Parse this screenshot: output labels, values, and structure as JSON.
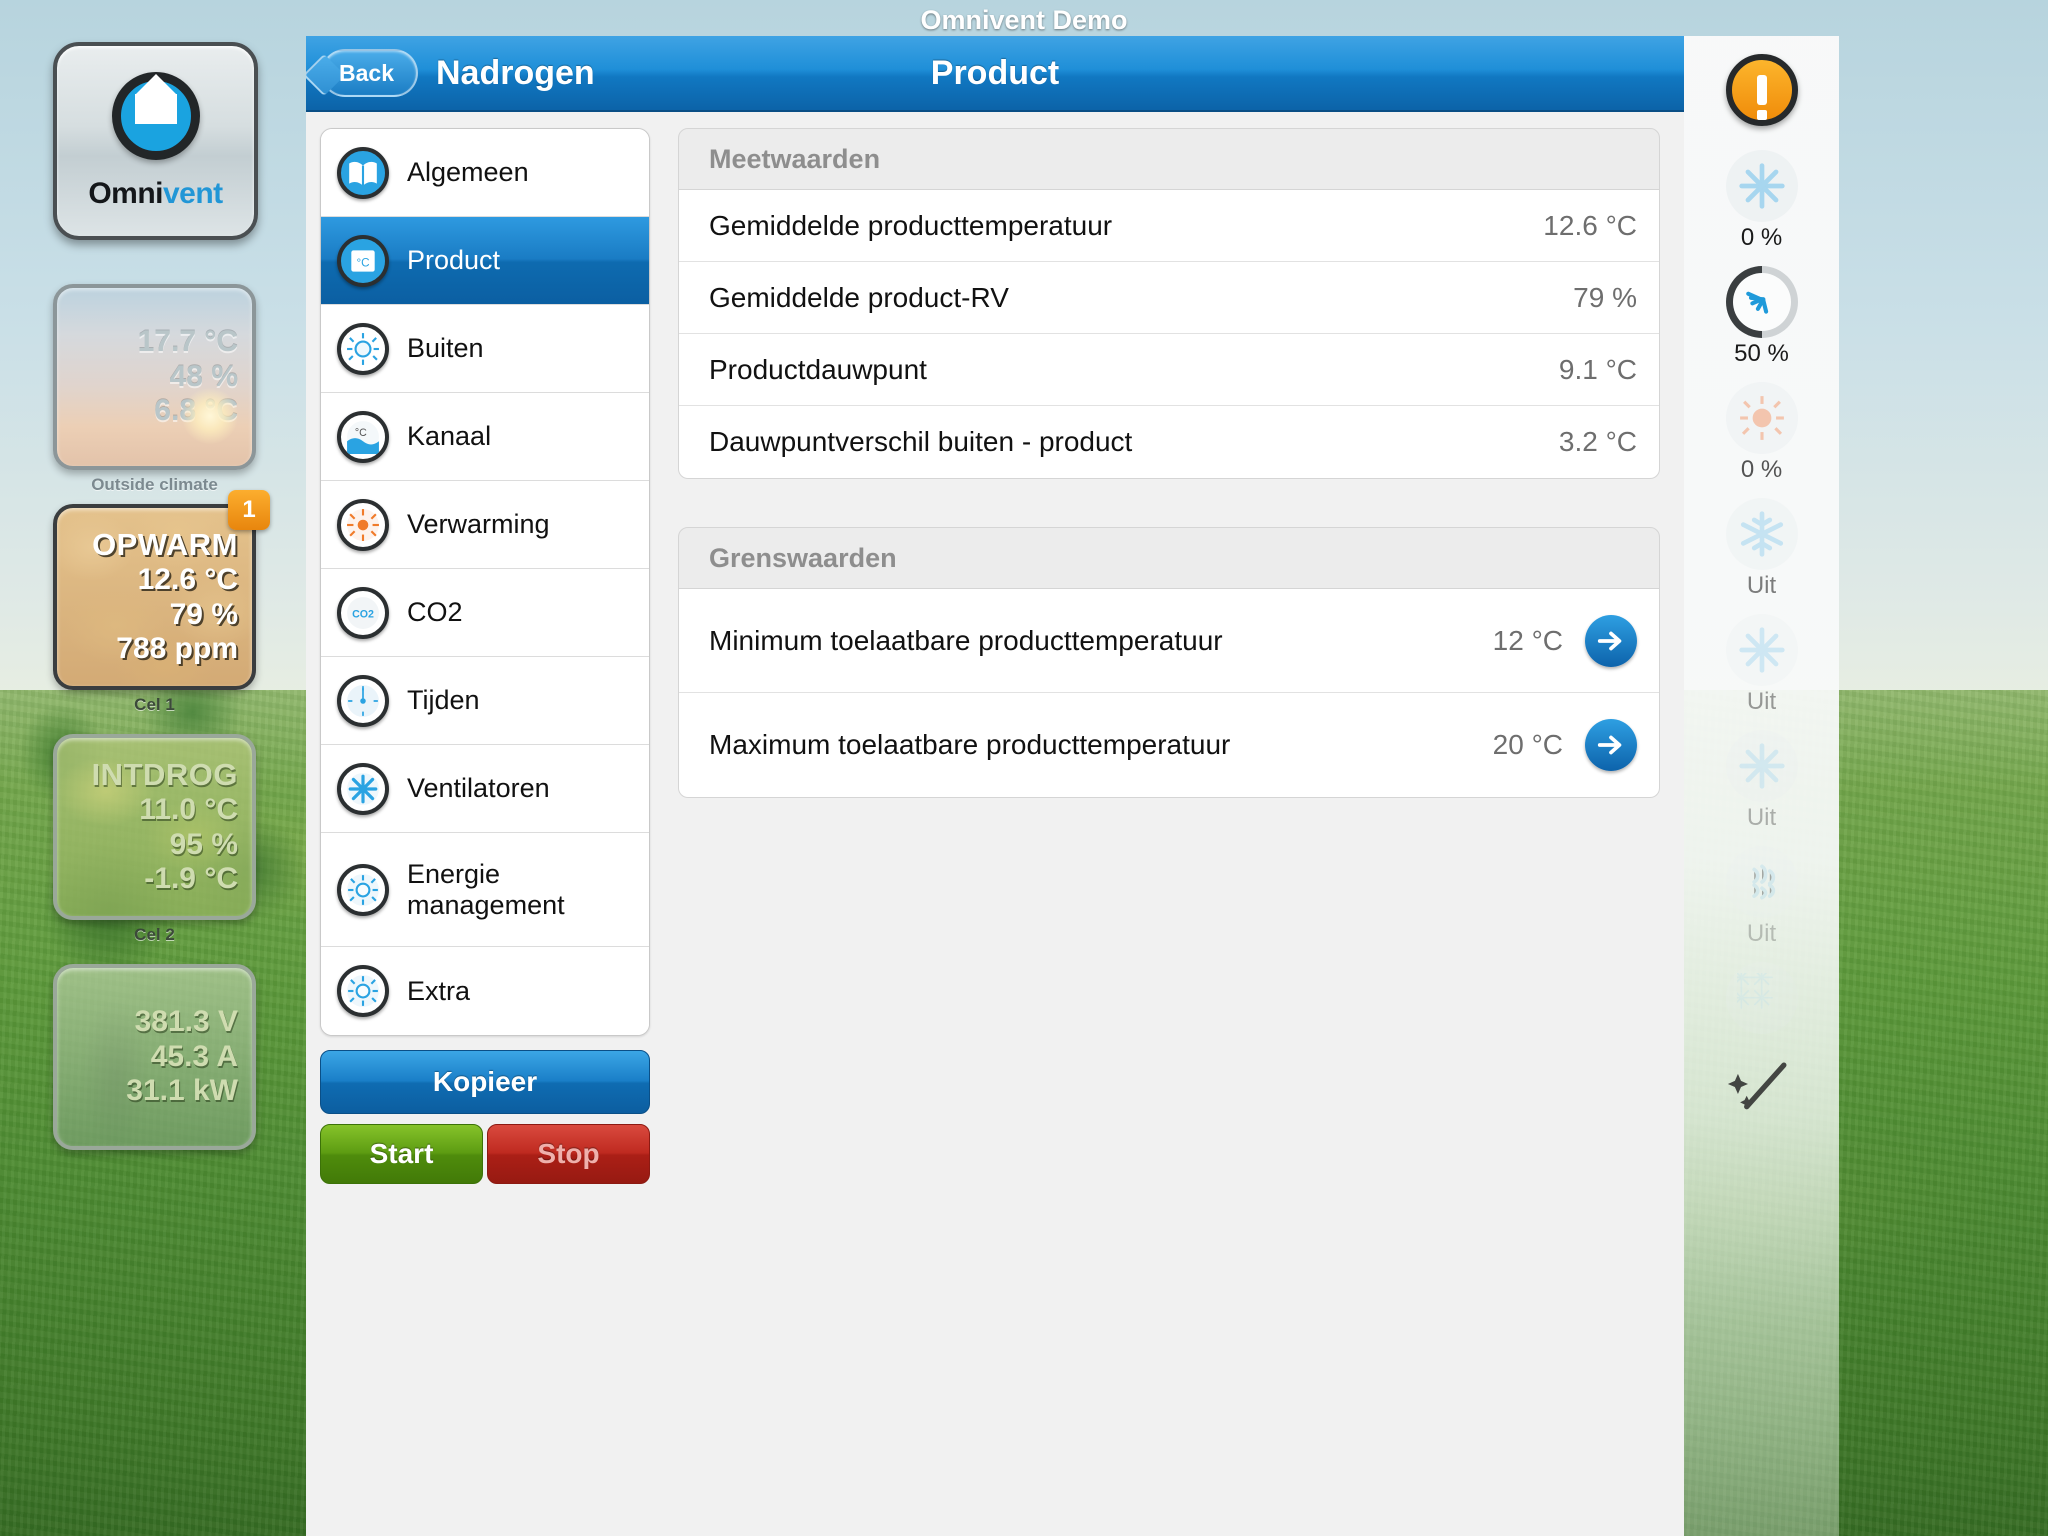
{
  "window": {
    "title": "Omnivent Demo"
  },
  "brand": {
    "name_part1": "Omni",
    "name_part2": "vent",
    "logo_icon": "house-icon"
  },
  "left_panels": {
    "outside": {
      "caption": "Outside climate",
      "temperature": "17.7 °C",
      "humidity": "48 %",
      "dewpoint": "6.8 °C"
    },
    "cell1": {
      "caption": "Cel 1",
      "badge": "1",
      "mode": "OPWARM",
      "temperature": "12.6 °C",
      "humidity": "79 %",
      "co2": "788 ppm"
    },
    "cell2": {
      "caption": "Cel 2",
      "mode": "INTDROG",
      "temperature": "11.0 °C",
      "humidity": "95 %",
      "dewpoint": "-1.9 °C"
    },
    "power": {
      "voltage": "381.3 V",
      "current": "45.3 A",
      "power": "31.1 kW"
    }
  },
  "navbar": {
    "back_label": "Back",
    "section_label": "Nadrogen",
    "title": "Product"
  },
  "menu": {
    "items": [
      {
        "label": "Algemeen",
        "icon": "book-icon",
        "active": false
      },
      {
        "label": "Product",
        "icon": "product-temperature-icon",
        "active": true
      },
      {
        "label": "Buiten",
        "icon": "sun-gear-icon",
        "active": false
      },
      {
        "label": "Kanaal",
        "icon": "channel-temperature-icon",
        "active": false
      },
      {
        "label": "Verwarming",
        "icon": "heater-icon",
        "active": false
      },
      {
        "label": "CO2",
        "icon": "co2-icon",
        "active": false
      },
      {
        "label": "Tijden",
        "icon": "clock-icon",
        "active": false
      },
      {
        "label": "Ventilatoren",
        "icon": "fan-icon",
        "active": false
      },
      {
        "label": "Energie management",
        "icon": "energy-gear-icon",
        "active": false
      },
      {
        "label": "Extra",
        "icon": "extra-gear-icon",
        "active": false
      }
    ],
    "copy_button": "Kopieer",
    "start_button": "Start",
    "stop_button": "Stop"
  },
  "detail": {
    "measurements": {
      "header": "Meetwaarden",
      "rows": [
        {
          "label": "Gemiddelde producttemperatuur",
          "value": "12.6 °C"
        },
        {
          "label": "Gemiddelde product-RV",
          "value": "79 %"
        },
        {
          "label": "Productdauwpunt",
          "value": "9.1 °C"
        },
        {
          "label": "Dauwpuntverschil buiten - product",
          "value": "3.2 °C"
        }
      ]
    },
    "limits": {
      "header": "Grenswaarden",
      "rows": [
        {
          "label": "Minimum toelaatbare producttemperatuur",
          "value": "12 °C",
          "arrow": "arrow-right-icon"
        },
        {
          "label": "Maximum toelaatbare producttemperatuur",
          "value": "20 °C",
          "arrow": "arrow-right-icon"
        }
      ]
    }
  },
  "status_rail": {
    "items": [
      {
        "icon": "warning-icon",
        "label": "",
        "state": "alert"
      },
      {
        "icon": "fan-icon",
        "label": "0 %",
        "state": "off"
      },
      {
        "icon": "valve-gauge-icon",
        "label": "50 %",
        "state": "on"
      },
      {
        "icon": "heater-icon",
        "label": "0 %",
        "state": "off"
      },
      {
        "icon": "snowflake-icon",
        "label": "Uit",
        "state": "off"
      },
      {
        "icon": "fan-icon",
        "label": "Uit",
        "state": "off"
      },
      {
        "icon": "fan-icon",
        "label": "Uit",
        "state": "off"
      },
      {
        "icon": "humidifier-icon",
        "label": "Uit",
        "state": "off"
      },
      {
        "icon": "multi-fan-icon",
        "label": "",
        "state": "off"
      },
      {
        "icon": "magic-wand-icon",
        "label": "",
        "state": "off"
      }
    ]
  },
  "colors": {
    "accent_blue": "#1a7cc4",
    "alert_orange": "#f4a01a",
    "start_green": "#5d9c12",
    "stop_red": "#bf2a20"
  }
}
